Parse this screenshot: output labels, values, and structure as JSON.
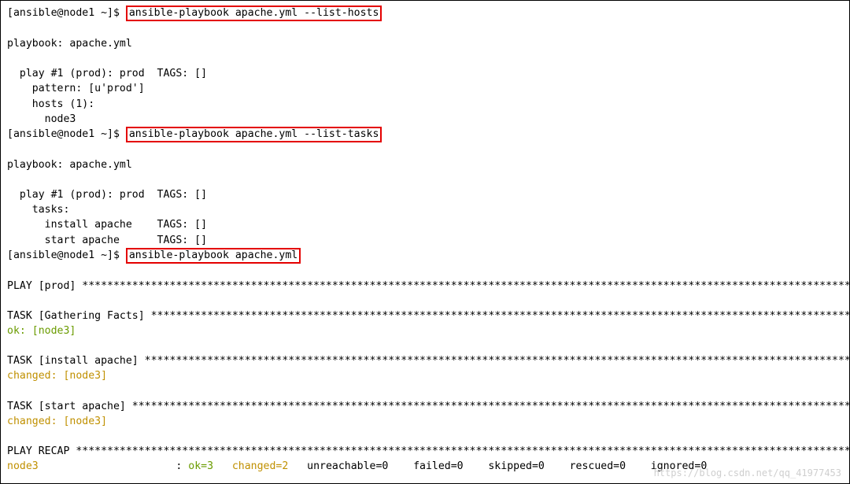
{
  "prompt": "[ansible@node1 ~]$ ",
  "cmd1": "ansible-playbook apache.yml --list-hosts",
  "cmd2": "ansible-playbook apache.yml --list-tasks",
  "cmd3": "ansible-playbook apache.yml",
  "listHosts": {
    "header": "playbook: apache.yml",
    "play": "  play #1 (prod): prod  TAGS: []",
    "pattern": "    pattern: [u'prod']",
    "hosts": "    hosts (1):",
    "node": "      node3"
  },
  "listTasks": {
    "header": "playbook: apache.yml",
    "play": "  play #1 (prod): prod  TAGS: []",
    "tasksLabel": "    tasks:",
    "t1": "      install apache    TAGS: []",
    "t2": "      start apache      TAGS: []"
  },
  "run": {
    "playHeader": "PLAY [prod] *********************************************************************************************************************************",
    "taskGather": "TASK [Gathering Facts] **********************************************************************************************************************",
    "okNode3": "ok: [node3]",
    "taskInstall": "TASK [install apache] ***********************************************************************************************************************",
    "changedNode3a": "changed: [node3]",
    "taskStart": "TASK [start apache] *************************************************************************************************************************",
    "changedNode3b": "changed: [node3]",
    "recapHeader": "PLAY RECAP **********************************************************************************************************************************",
    "recapHost": "node3",
    "recapSep": "                      : ",
    "recapOk": "ok=3   ",
    "recapChanged": "changed=2   ",
    "recapRest": "unreachable=0    failed=0    skipped=0    rescued=0    ignored=0   "
  },
  "watermark": "https://blog.csdn.net/qq_41977453"
}
